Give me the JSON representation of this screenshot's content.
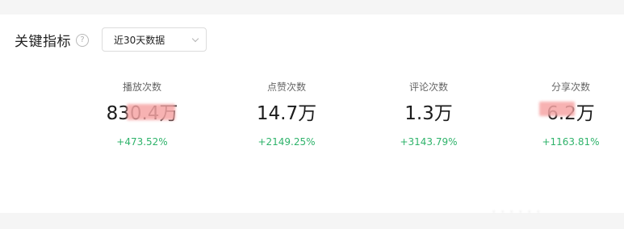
{
  "key_metrics": {
    "title": "关键指标",
    "help_icon": "question-circle-icon",
    "range_select": {
      "value": "近30天数据"
    }
  },
  "metrics": [
    {
      "label": "播放次数",
      "value": "830.4万",
      "change": "+473.52%"
    },
    {
      "label": "点赞次数",
      "value": "14.7万",
      "change": "+2149.25%"
    },
    {
      "label": "评论次数",
      "value": "1.3万",
      "change": "+3143.79%"
    },
    {
      "label": "分享次数",
      "value": "6.2万",
      "change": "+1163.81%"
    }
  ],
  "colors": {
    "positive_change": "#2fb36b",
    "redaction": "#f6a5a5"
  },
  "watermark": "· · · · · ·"
}
